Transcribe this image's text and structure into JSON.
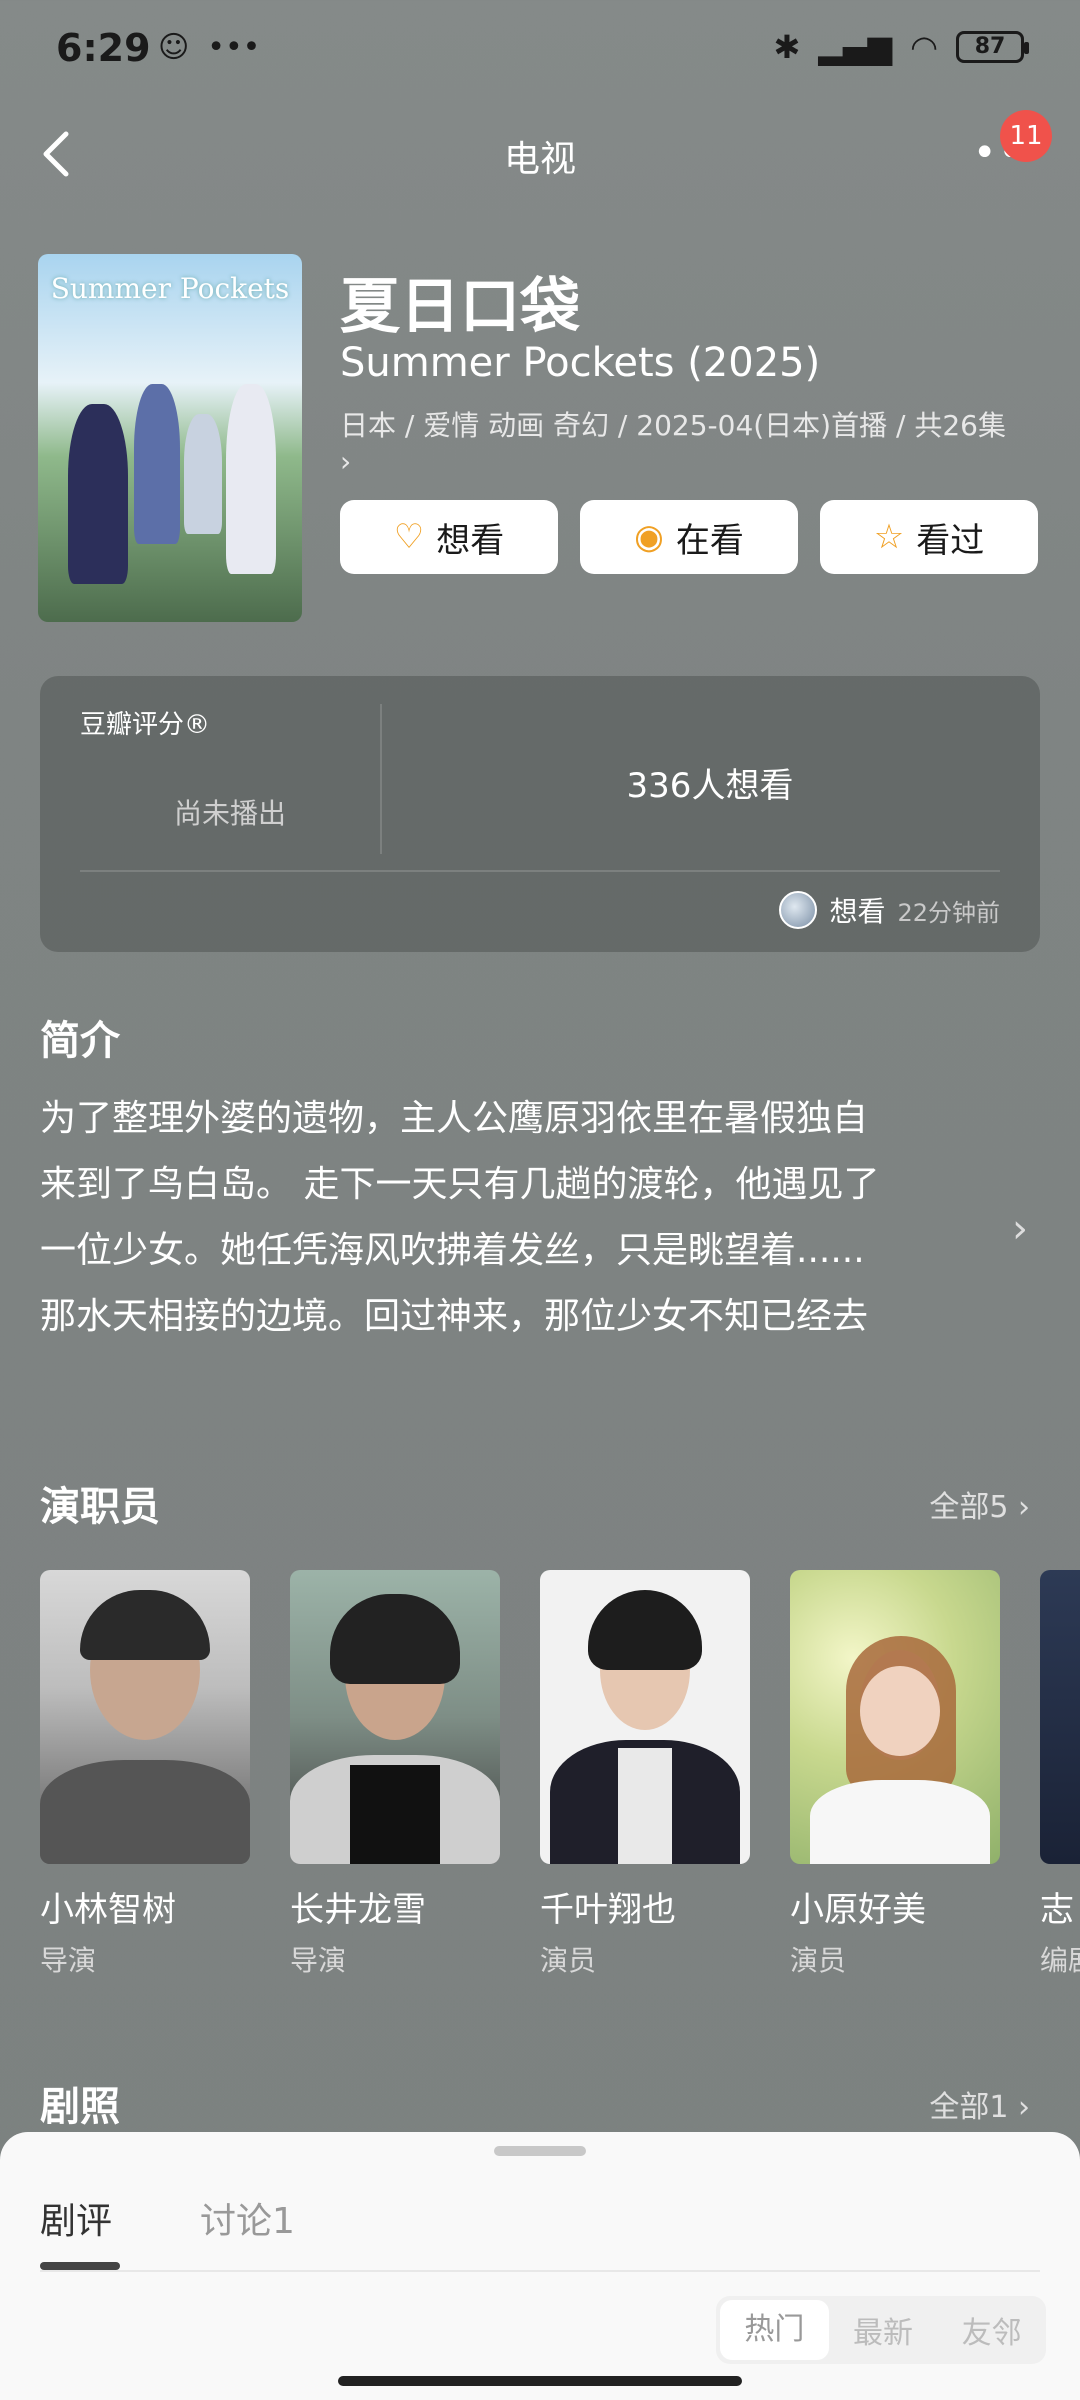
{
  "status_bar": {
    "time": "6:29",
    "extra": "•••",
    "battery": "87"
  },
  "nav": {
    "title": "电视",
    "more": "••",
    "badge": "11"
  },
  "header": {
    "poster_logo": "Summer Pockets",
    "title": "夏日口袋",
    "subtitle": "Summer Pockets (2025)",
    "meta": "日本 / 爱情 动画 奇幻 / 2025-04(日本)首播 / 共26集",
    "meta_arrow": "›",
    "buttons": [
      {
        "label": "想看",
        "icon": "heart-plus-icon"
      },
      {
        "label": "在看",
        "icon": "target-icon"
      },
      {
        "label": "看过",
        "icon": "star-icon"
      }
    ]
  },
  "rating": {
    "label": "豆瓣评分®",
    "status": "尚未播出",
    "want_count": "336人想看",
    "activity": {
      "action": "想看",
      "time": "22分钟前"
    }
  },
  "intro": {
    "title": "简介",
    "lines": [
      "为了整理外婆的遗物，主人公鹰原羽依里在暑假独自",
      "来到了鸟白岛。 走下一天只有几趟的渡轮，他遇见了",
      "一位少女。她任凭海风吹拂着发丝，只是眺望着......",
      "那水天相接的边境。回过神来，那位少女不知已经去"
    ]
  },
  "cast": {
    "title": "演职员",
    "more": "全部5 ›",
    "people": [
      {
        "name": "小林智树",
        "role": "导演"
      },
      {
        "name": "长井龙雪",
        "role": "导演"
      },
      {
        "name": "千叶翔也",
        "role": "演员"
      },
      {
        "name": "小原好美",
        "role": "演员"
      },
      {
        "name": "志",
        "role": "编剧"
      }
    ]
  },
  "photos": {
    "title": "剧照",
    "more": "全部1 ›"
  },
  "sheet": {
    "tabs": [
      "剧评",
      "讨论1"
    ],
    "sort": [
      "热门",
      "最新",
      "友邻"
    ]
  }
}
